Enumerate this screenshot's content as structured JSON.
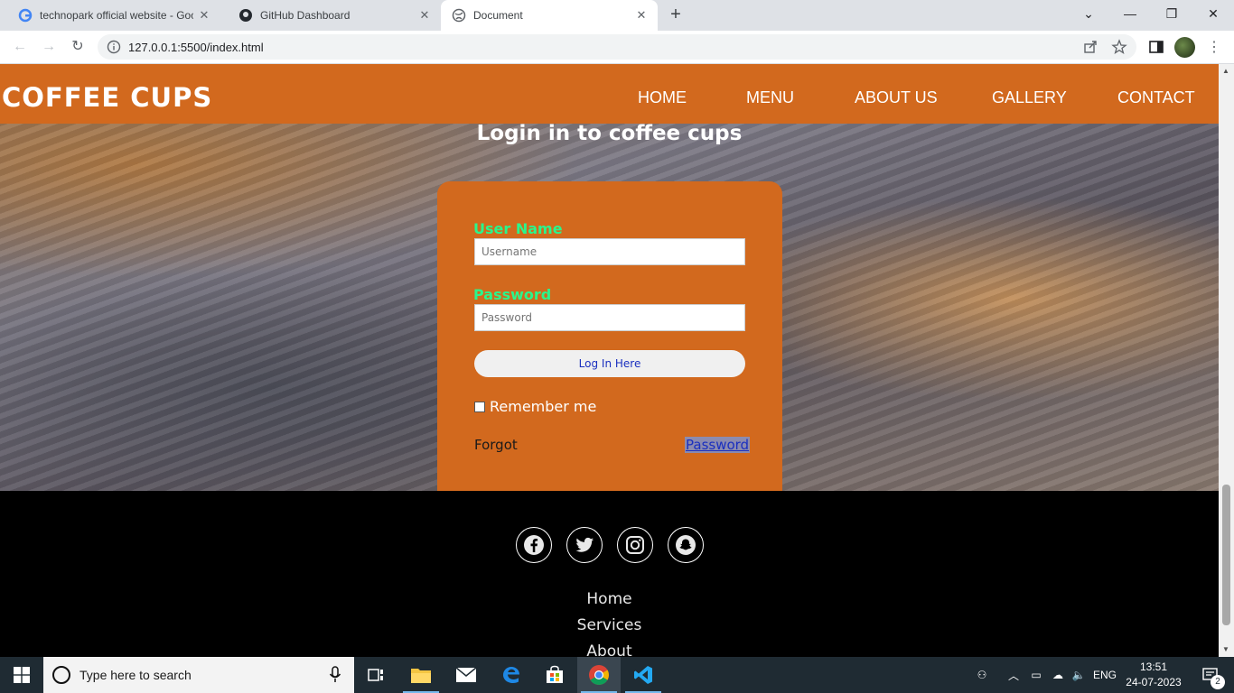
{
  "browser": {
    "tabs": [
      {
        "title": "technopark official website - Goo",
        "active": false,
        "icon": "google-icon"
      },
      {
        "title": "GitHub Dashboard",
        "active": false,
        "icon": "github-icon"
      },
      {
        "title": "Document",
        "active": true,
        "icon": "globe-icon"
      }
    ],
    "url": "127.0.0.1:5500/index.html"
  },
  "page": {
    "brand": "COFFEE CUPS",
    "nav": [
      "HOME",
      "MENU",
      "ABOUT US",
      "GALLERY",
      "CONTACT"
    ],
    "login": {
      "title": "Login in to coffee cups",
      "username_label": "User Name",
      "username_placeholder": "Username",
      "password_label": "Password",
      "password_placeholder": "Password",
      "button": "Log In Here",
      "remember": "Remember me",
      "forgot": "Forgot",
      "password_link": "Password"
    },
    "footer": {
      "social": [
        "facebook-icon",
        "twitter-icon",
        "instagram-icon",
        "snapchat-icon"
      ],
      "links": [
        "Home",
        "Services",
        "About"
      ]
    },
    "colors": {
      "accent": "#d2691e",
      "label": "#2af58c"
    }
  },
  "taskbar": {
    "search_placeholder": "Type here to search",
    "language": "ENG",
    "time": "13:51",
    "date": "24-07-2023",
    "notifications": "2"
  }
}
